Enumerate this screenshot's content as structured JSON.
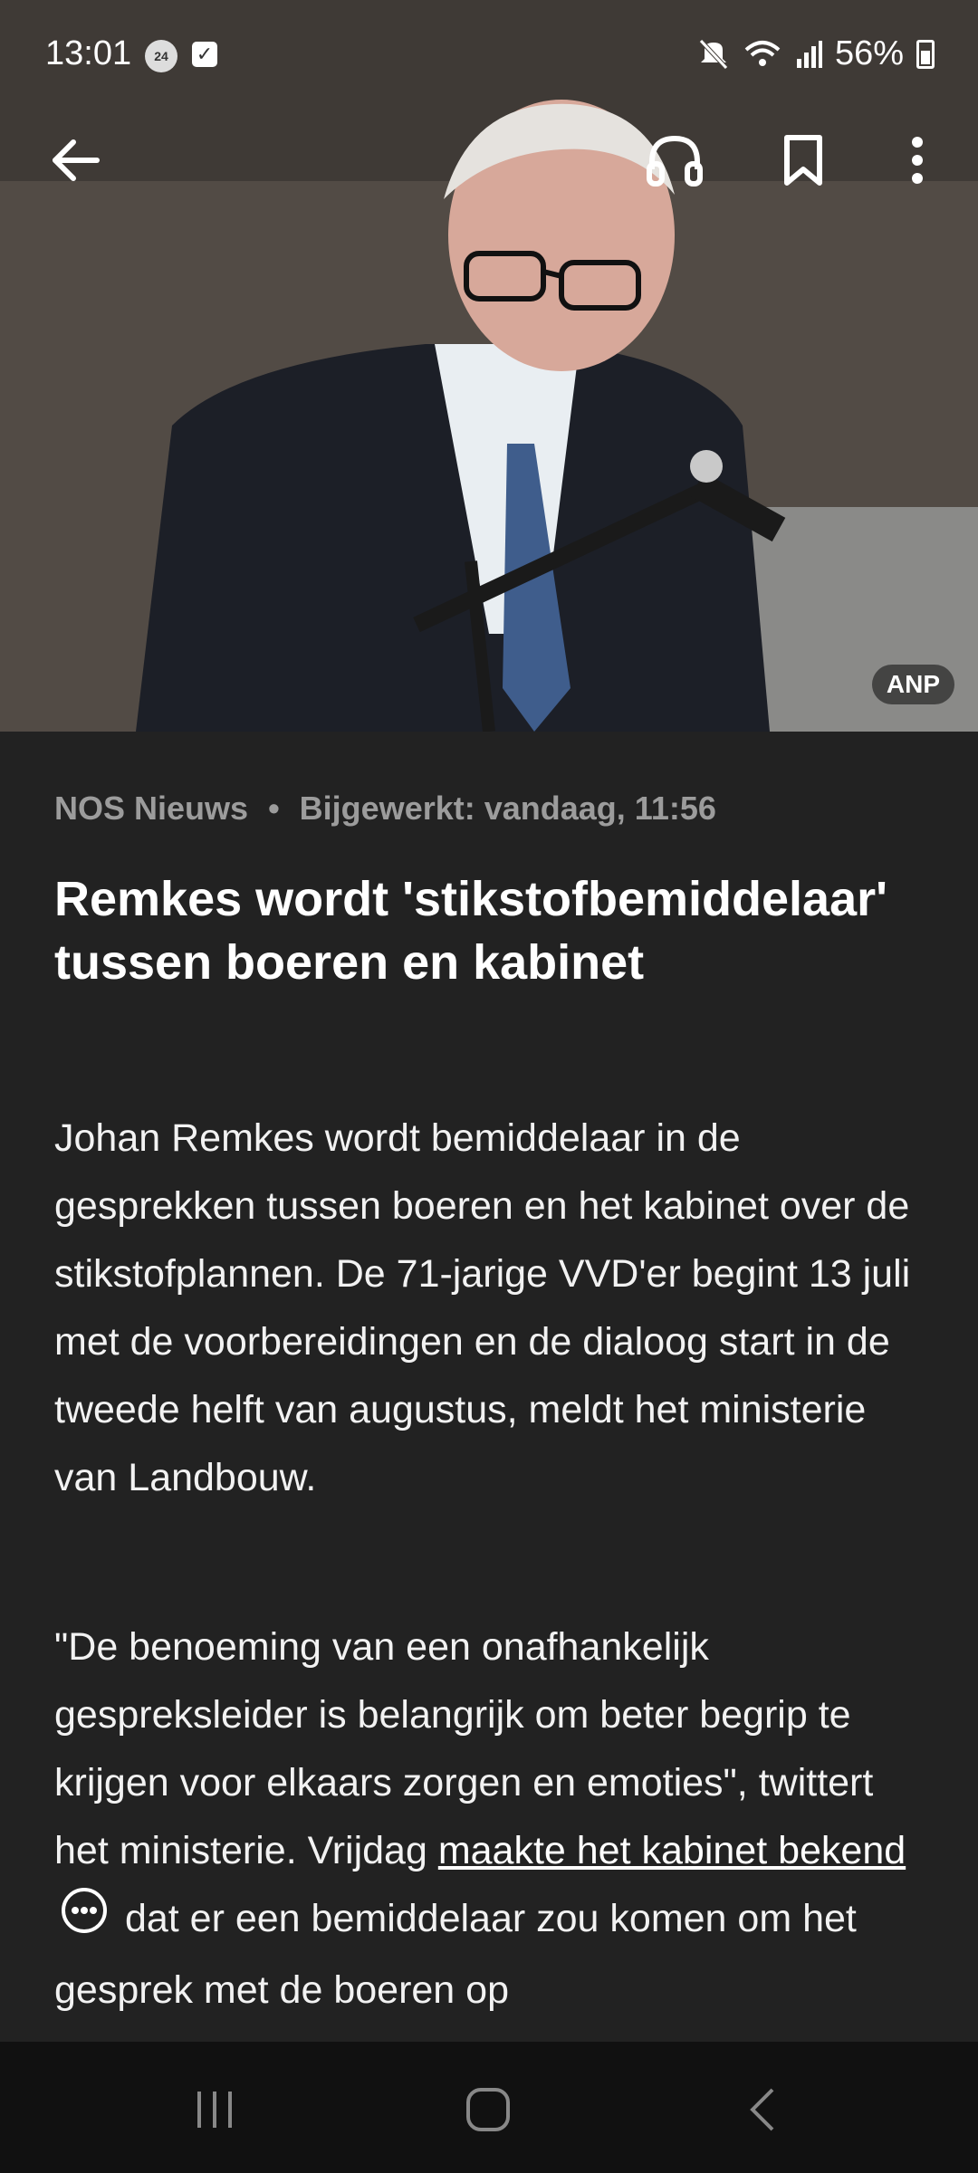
{
  "status": {
    "time": "13:01",
    "baby_badge": "24 BABY",
    "battery": "56%"
  },
  "hero": {
    "photo_credit": "ANP"
  },
  "article": {
    "source": "NOS Nieuws",
    "separator": "•",
    "updated": "Bijgewerkt: vandaag, 11:56",
    "headline": "Remkes wordt 'stikstofbemiddelaar' tussen boeren en kabinet",
    "p1": "Johan Remkes wordt bemiddelaar in de gesprekken tussen boeren en het kabinet over de stikstofplannen. De 71-jarige VVD'er begint 13 juli met de voorbereidingen en de dialoog start in de tweede helft van augustus, meldt het ministerie van Landbouw.",
    "p2_before": "\"De benoeming van een onafhankelijk gespreksleider is belangrijk om beter begrip te krijgen voor elkaars zorgen en emoties\", twittert het ministerie. Vrijdag ",
    "p2_link": "maakte het kabinet bekend",
    "p2_after": " dat er een bemiddelaar zou komen om het gesprek met de boeren op"
  },
  "icons": {
    "back": "back-arrow-icon",
    "audio": "headphones-icon",
    "bookmark": "bookmark-icon",
    "more": "more-vertical-icon"
  }
}
